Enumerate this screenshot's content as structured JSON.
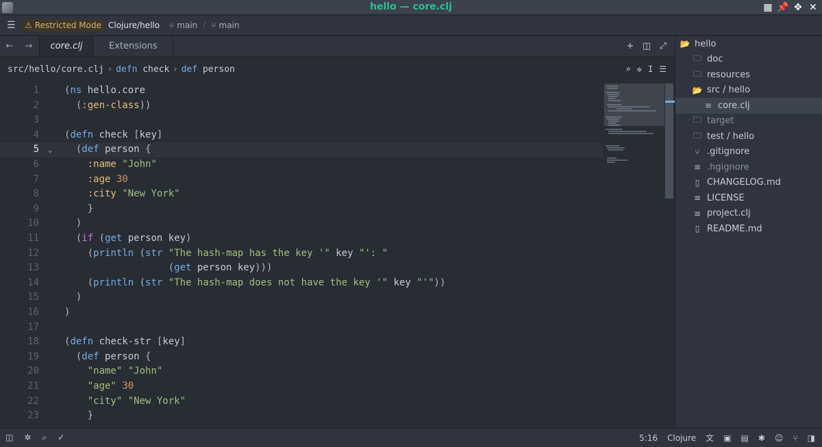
{
  "window": {
    "title": "hello — core.clj"
  },
  "topbar": {
    "restricted_label": "Restricted Mode",
    "project": "Clojure/hello",
    "branch1": "main",
    "branch2": "main"
  },
  "tabs": [
    {
      "label": "core.clj",
      "active": true
    },
    {
      "label": "Extensions",
      "active": false
    }
  ],
  "breadcrumb": {
    "path": "src/hello/core.clj",
    "kw1": "defn",
    "sym1": "check",
    "kw2": "def",
    "sym2": "person"
  },
  "editor": {
    "current_line": 5,
    "line_numbers": [
      "1",
      "2",
      "3",
      "4",
      "5",
      "6",
      "7",
      "8",
      "9",
      "10",
      "11",
      "12",
      "13",
      "14",
      "15",
      "16",
      "17",
      "18",
      "19",
      "20",
      "21",
      "22",
      "23"
    ]
  },
  "sidebar": {
    "items": [
      {
        "label": "hello",
        "icon": "folder-open-icon",
        "indent": 0
      },
      {
        "label": "doc",
        "icon": "folder-icon",
        "indent": 1
      },
      {
        "label": "resources",
        "icon": "folder-icon",
        "indent": 1
      },
      {
        "label": "src / hello",
        "icon": "folder-open-icon",
        "indent": 1
      },
      {
        "label": "core.clj",
        "icon": "file-lines-icon",
        "indent": 2,
        "selected": true
      },
      {
        "label": "target",
        "icon": "folder-icon",
        "indent": 1,
        "dim": true
      },
      {
        "label": "test / hello",
        "icon": "folder-icon",
        "indent": 1
      },
      {
        "label": ".gitignore",
        "icon": "git-icon",
        "indent": 1
      },
      {
        "label": ".hgignore",
        "icon": "file-lines-icon",
        "indent": 1,
        "dim": true
      },
      {
        "label": "CHANGELOG.md",
        "icon": "book-icon",
        "indent": 1
      },
      {
        "label": "LICENSE",
        "icon": "file-lines-icon",
        "indent": 1
      },
      {
        "label": "project.clj",
        "icon": "file-lines-icon",
        "indent": 1
      },
      {
        "label": "README.md",
        "icon": "book-icon",
        "indent": 1
      }
    ]
  },
  "status": {
    "cursor": "5:16",
    "language": "Clojure"
  }
}
